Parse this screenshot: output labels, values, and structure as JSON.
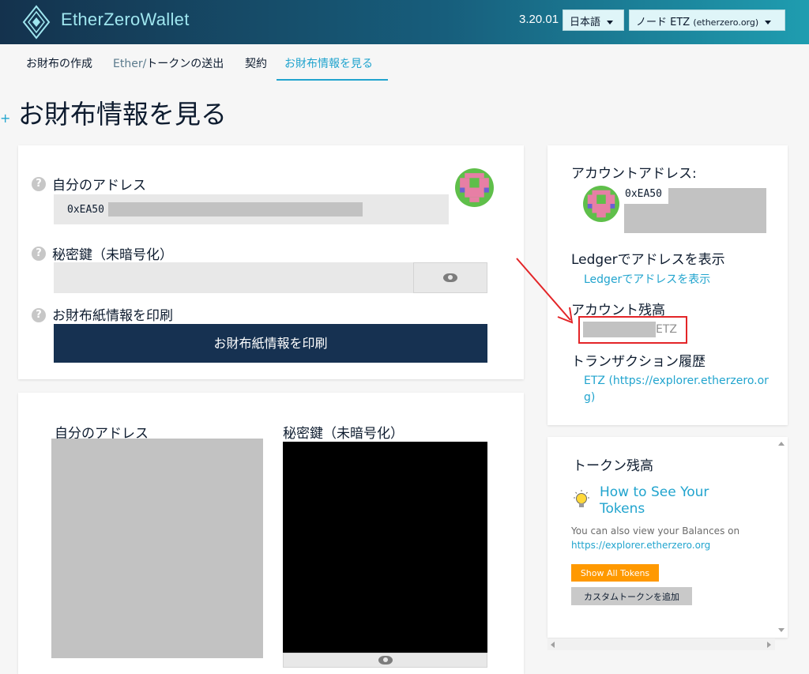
{
  "header": {
    "brand": "EtherZeroWallet",
    "version": "3.20.01",
    "language_dropdown": "日本語",
    "node_dropdown_main": "ノード ETZ ",
    "node_dropdown_host": "(etherzero.org)"
  },
  "nav": {
    "tabs": [
      {
        "label": "お財布の作成"
      },
      {
        "label_prefix": "Ether/",
        "label": "トークンの送出"
      },
      {
        "label": "契約"
      },
      {
        "label": "お財布情報を見る"
      }
    ]
  },
  "page": {
    "plus": "+",
    "title": "お財布情報を見る"
  },
  "wallet_panel": {
    "help_icon": "?",
    "address_label": "自分のアドレス",
    "address_value": "0xEA50",
    "private_key_label": "秘密鍵（未暗号化）",
    "print_label": "お財布紙情報を印刷",
    "print_button": "お財布紙情報を印刷"
  },
  "paper_panel": {
    "address_label": "自分のアドレス",
    "private_key_label": "秘密鍵（未暗号化）"
  },
  "account_panel": {
    "account_address_label": "アカウントアドレス:",
    "account_address_value": "0xEA50",
    "ledger_heading": "Ledgerでアドレスを表示",
    "ledger_link": "Ledgerでアドレスを表示",
    "balance_heading": "アカウント残高",
    "balance_unit": "ETZ",
    "tx_history_heading": "トランザクション履歴",
    "tx_history_link_line1": "ETZ (https://explorer.etherzero.or",
    "tx_history_link_line2": "g)"
  },
  "token_panel": {
    "heading": "トークン残高",
    "how_to_line1": "How to See Your",
    "how_to_line2": "Tokens",
    "info_line1": "You can also view your Balances on",
    "info_link": "https://explorer.etherzero.org",
    "show_all_button": "Show All Tokens",
    "add_custom_button": "カスタムトークンを追加"
  },
  "icons": {
    "logo": "etherzero-diamond-logo",
    "help": "question-circle-icon",
    "eye": "eye-icon",
    "bulb": "lightbulb-icon",
    "avatar": "identicon-avatar"
  },
  "colors": {
    "accent": "#21a4ce",
    "dark_button": "#163151",
    "orange_button": "#ff9900",
    "highlight_box": "#e32528"
  }
}
